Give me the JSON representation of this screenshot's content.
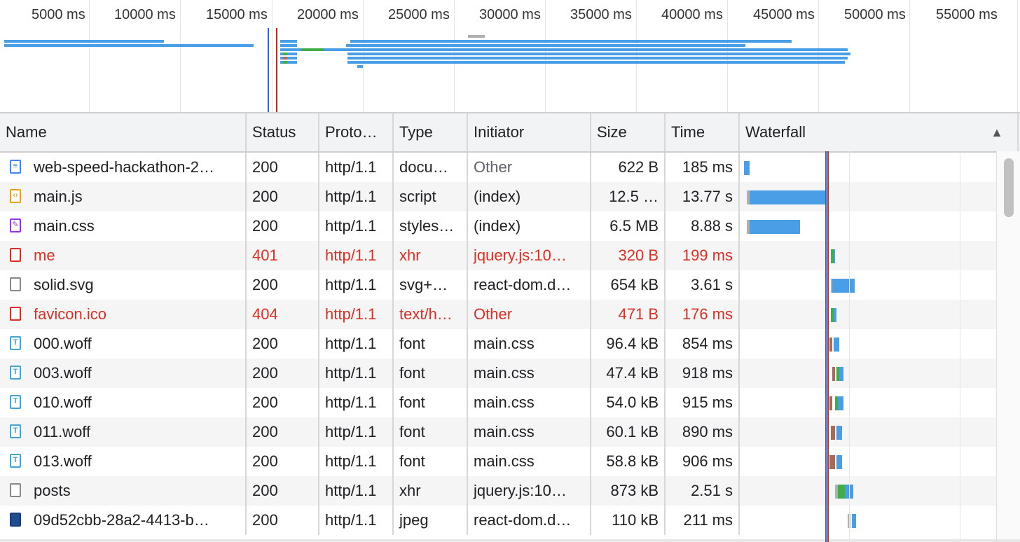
{
  "overview": {
    "ticks": [
      "5000 ms",
      "10000 ms",
      "15000 ms",
      "20000 ms",
      "25000 ms",
      "30000 ms",
      "35000 ms",
      "40000 ms",
      "45000 ms",
      "50000 ms",
      "55000 ms"
    ]
  },
  "columns": {
    "name": "Name",
    "status": "Status",
    "protocol": "Proto…",
    "type": "Type",
    "initiator": "Initiator",
    "size": "Size",
    "time": "Time",
    "waterfall": "Waterfall",
    "sort_indicator": "▲"
  },
  "rows": [
    {
      "name": "web-speed-hackathon-2…",
      "status": "200",
      "protocol": "http/1.1",
      "type": "docu…",
      "initiator": "Other",
      "initiator_link": false,
      "size": "622 B",
      "time": "185 ms",
      "icon": "document-icon",
      "error": false
    },
    {
      "name": "main.js",
      "status": "200",
      "protocol": "http/1.1",
      "type": "script",
      "initiator": "(index)",
      "initiator_link": true,
      "size": "12.5 …",
      "time": "13.77 s",
      "icon": "script-icon",
      "error": false
    },
    {
      "name": "main.css",
      "status": "200",
      "protocol": "http/1.1",
      "type": "styles…",
      "initiator": "(index)",
      "initiator_link": true,
      "size": "6.5 MB",
      "time": "8.88 s",
      "icon": "stylesheet-icon",
      "error": false
    },
    {
      "name": "me",
      "status": "401",
      "protocol": "http/1.1",
      "type": "xhr",
      "initiator": "jquery.js:10…",
      "initiator_link": true,
      "size": "320 B",
      "time": "199 ms",
      "icon": "error-file-icon",
      "error": true
    },
    {
      "name": "solid.svg",
      "status": "200",
      "protocol": "http/1.1",
      "type": "svg+…",
      "initiator": "react-dom.d…",
      "initiator_link": true,
      "size": "654 kB",
      "time": "3.61 s",
      "icon": "file-icon",
      "error": false
    },
    {
      "name": "favicon.ico",
      "status": "404",
      "protocol": "http/1.1",
      "type": "text/h…",
      "initiator": "Other",
      "initiator_link": false,
      "size": "471 B",
      "time": "176 ms",
      "icon": "error-file-icon",
      "error": true
    },
    {
      "name": "000.woff",
      "status": "200",
      "protocol": "http/1.1",
      "type": "font",
      "initiator": "main.css",
      "initiator_link": true,
      "size": "96.4 kB",
      "time": "854 ms",
      "icon": "font-icon",
      "error": false
    },
    {
      "name": "003.woff",
      "status": "200",
      "protocol": "http/1.1",
      "type": "font",
      "initiator": "main.css",
      "initiator_link": true,
      "size": "47.4 kB",
      "time": "918 ms",
      "icon": "font-icon",
      "error": false
    },
    {
      "name": "010.woff",
      "status": "200",
      "protocol": "http/1.1",
      "type": "font",
      "initiator": "main.css",
      "initiator_link": true,
      "size": "54.0 kB",
      "time": "915 ms",
      "icon": "font-icon",
      "error": false
    },
    {
      "name": "011.woff",
      "status": "200",
      "protocol": "http/1.1",
      "type": "font",
      "initiator": "main.css",
      "initiator_link": true,
      "size": "60.1 kB",
      "time": "890 ms",
      "icon": "font-icon",
      "error": false
    },
    {
      "name": "013.woff",
      "status": "200",
      "protocol": "http/1.1",
      "type": "font",
      "initiator": "main.css",
      "initiator_link": true,
      "size": "58.8 kB",
      "time": "906 ms",
      "icon": "font-icon",
      "error": false
    },
    {
      "name": "posts",
      "status": "200",
      "protocol": "http/1.1",
      "type": "xhr",
      "initiator": "jquery.js:10…",
      "initiator_link": true,
      "size": "873 kB",
      "time": "2.51 s",
      "icon": "file-icon",
      "error": false
    },
    {
      "name": "09d52cbb-28a2-4413-b…",
      "status": "200",
      "protocol": "http/1.1",
      "type": "jpeg",
      "initiator": "react-dom.d…",
      "initiator_link": true,
      "size": "110 kB",
      "time": "211 ms",
      "icon": "image-icon",
      "error": false
    }
  ],
  "colors": {
    "waiting": "#3fae49",
    "download": "#4a9ee6",
    "queue": "#b0b0b0",
    "blocked": "#a86a5c",
    "dom_content_loaded": "#2f5fd4",
    "load": "#b32d22",
    "error_text": "#d93025"
  }
}
